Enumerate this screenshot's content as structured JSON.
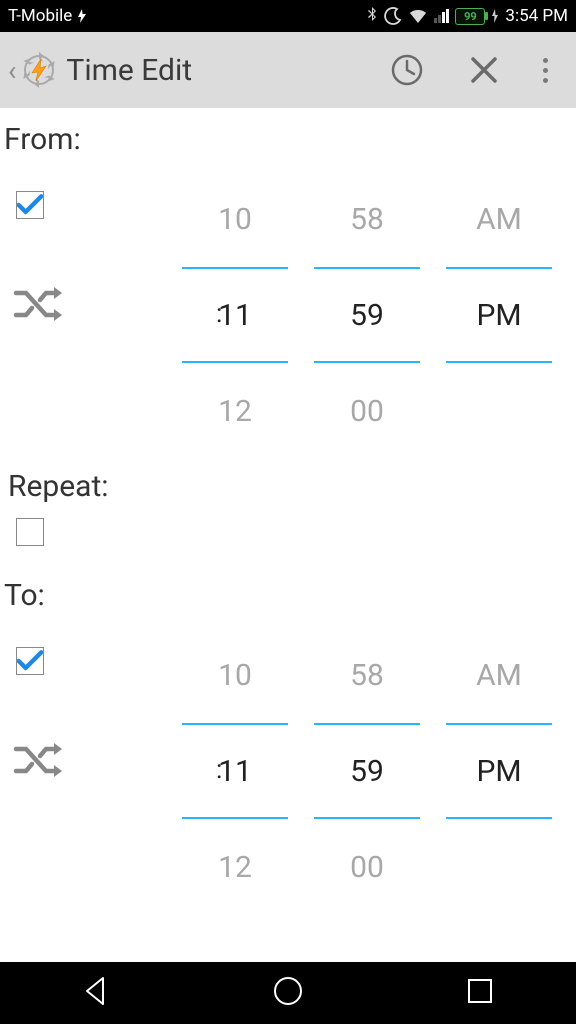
{
  "status": {
    "carrier": "T-Mobile",
    "battery": "99",
    "time": "3:54 PM"
  },
  "appbar": {
    "title": "Time Edit"
  },
  "labels": {
    "from": "From:",
    "repeat": "Repeat:",
    "to": "To:"
  },
  "from": {
    "checked": true,
    "hour_prev": "10",
    "hour_cur": "11",
    "hour_next": "12",
    "min_prev": "58",
    "min_cur": "59",
    "min_next": "00",
    "ampm_prev": "AM",
    "ampm_cur": "PM",
    "ampm_next": ""
  },
  "repeat": {
    "checked": false
  },
  "to": {
    "checked": true,
    "hour_prev": "10",
    "hour_cur": "11",
    "hour_next": "12",
    "min_prev": "58",
    "min_cur": "59",
    "min_next": "00",
    "ampm_prev": "AM",
    "ampm_cur": "PM",
    "ampm_next": ""
  },
  "colon": ":"
}
